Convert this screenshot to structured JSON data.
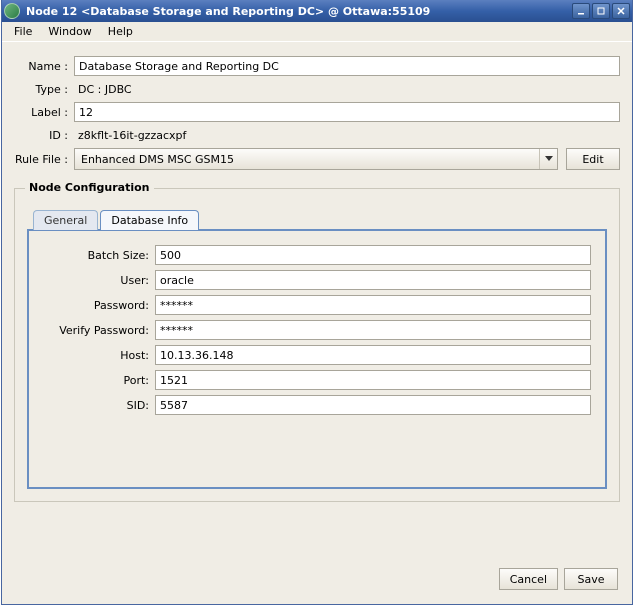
{
  "window": {
    "title": "Node 12 <Database Storage and Reporting DC> @ Ottawa:55109"
  },
  "menubar": {
    "file": "File",
    "window": "Window",
    "help": "Help"
  },
  "labels": {
    "name": "Name :",
    "type": "Type :",
    "label": "Label :",
    "id": "ID :",
    "rulefile": "Rule File :"
  },
  "fields": {
    "name": "Database Storage and Reporting DC",
    "type": "DC : JDBC",
    "label": "12",
    "id": "z8kflt-16it-gzzacxpf",
    "rulefile": "Enhanced DMS MSC GSM15"
  },
  "buttons": {
    "edit": "Edit",
    "cancel": "Cancel",
    "save": "Save"
  },
  "section": {
    "title": "Node Configuration"
  },
  "tabs": {
    "general": "General",
    "dbinfo": "Database Info"
  },
  "db": {
    "labels": {
      "batch": "Batch Size:",
      "user": "User:",
      "password": "Password:",
      "verify": "Verify Password:",
      "host": "Host:",
      "port": "Port:",
      "sid": "SID:"
    },
    "values": {
      "batch": "500",
      "user": "oracle",
      "password": "******",
      "verify": "******",
      "host": "10.13.36.148",
      "port": "1521",
      "sid": "5587"
    }
  }
}
